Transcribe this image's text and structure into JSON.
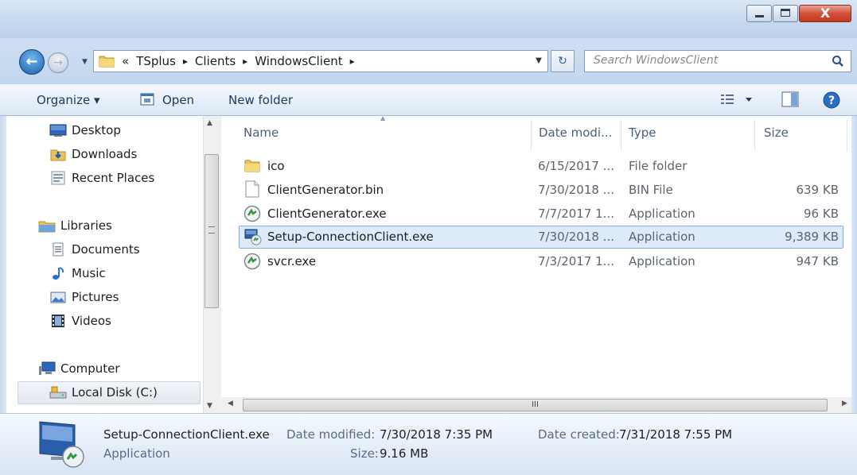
{
  "window": {
    "close_glyph": "X",
    "minimize_glyph": "_",
    "maximize_glyph": "□"
  },
  "address": {
    "prefix": "«",
    "crumbs": [
      "TSplus",
      "Clients",
      "WindowsClient"
    ],
    "sep": "▸",
    "search_placeholder": "Search WindowsClient"
  },
  "toolbar": {
    "organize": "Organize ▾",
    "open": "Open",
    "new_folder": "New folder"
  },
  "nav": {
    "favorites": [
      {
        "label": "Desktop",
        "icon": "desktop-icon"
      },
      {
        "label": "Downloads",
        "icon": "downloads-icon"
      },
      {
        "label": "Recent Places",
        "icon": "recent-places-icon"
      }
    ],
    "libraries": {
      "label": "Libraries",
      "icon": "libraries-icon"
    },
    "library_items": [
      {
        "label": "Documents",
        "icon": "documents-icon"
      },
      {
        "label": "Music",
        "icon": "music-icon"
      },
      {
        "label": "Pictures",
        "icon": "pictures-icon"
      },
      {
        "label": "Videos",
        "icon": "videos-icon"
      }
    ],
    "computer": {
      "label": "Computer",
      "icon": "computer-icon"
    },
    "local_disk": {
      "label": "Local Disk (C:)",
      "icon": "local-disk-icon"
    }
  },
  "columns": {
    "name": "Name",
    "date": "Date modi...",
    "type": "Type",
    "size": "Size"
  },
  "files": [
    {
      "name": "ico",
      "date": "6/15/2017 ...",
      "type": "File folder",
      "size": "",
      "icon": "folder-icon"
    },
    {
      "name": "ClientGenerator.bin",
      "date": "7/30/2018 ...",
      "type": "BIN File",
      "size": "639 KB",
      "icon": "file-icon"
    },
    {
      "name": "ClientGenerator.exe",
      "date": "7/7/2017 1...",
      "type": "Application",
      "size": "96 KB",
      "icon": "exe-icon"
    },
    {
      "name": "Setup-ConnectionClient.exe",
      "date": "7/30/2018 ...",
      "type": "Application",
      "size": "9,389 KB",
      "icon": "setup-exe-icon",
      "selected": true
    },
    {
      "name": "svcr.exe",
      "date": "7/3/2017 1...",
      "type": "Application",
      "size": "947 KB",
      "icon": "exe-icon"
    }
  ],
  "details": {
    "name": "Setup-ConnectionClient.exe",
    "kind": "Application",
    "date_modified_label": "Date modified:",
    "date_modified": "7/30/2018 7:35 PM",
    "size_label": "Size:",
    "size": "9.16 MB",
    "date_created_label": "Date created:",
    "date_created": "7/31/2018 7:55 PM"
  },
  "scrollbar": {
    "grip": "III"
  },
  "colors": {
    "selection_bg": "#dceaf9",
    "selection_border": "#84acdd",
    "accent": "#1d5fa9"
  }
}
